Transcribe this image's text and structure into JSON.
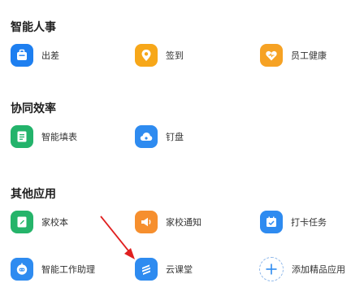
{
  "sections": [
    {
      "title": "智能人事",
      "items": [
        {
          "label": "出差",
          "icon": "briefcase-icon",
          "color": "#1E7FF0"
        },
        {
          "label": "签到",
          "icon": "location-pin-icon",
          "color": "#F7A719"
        },
        {
          "label": "员工健康",
          "icon": "heart-icon",
          "color": "#F6A224"
        }
      ]
    },
    {
      "title": "协同效率",
      "items": [
        {
          "label": "智能填表",
          "icon": "form-icon",
          "color": "#23B36B"
        },
        {
          "label": "钉盘",
          "icon": "cloud-icon",
          "color": "#2E8BF0"
        }
      ]
    },
    {
      "title": "其他应用",
      "items": [
        {
          "label": "家校本",
          "icon": "notebook-icon",
          "color": "#25B46A"
        },
        {
          "label": "家校通知",
          "icon": "megaphone-icon",
          "color": "#F68F2E"
        },
        {
          "label": "打卡任务",
          "icon": "calendar-check-icon",
          "color": "#2E8BF0"
        },
        {
          "label": "智能工作助理",
          "icon": "robot-icon",
          "color": "#2E8BF0"
        },
        {
          "label": "云课堂",
          "icon": "stripes-icon",
          "color": "#2E8BF0"
        },
        {
          "label": "添加精品应用",
          "icon": "plus-icon",
          "color": "#2E8BF0"
        }
      ]
    }
  ],
  "annotation": {
    "color": "#E02020"
  }
}
